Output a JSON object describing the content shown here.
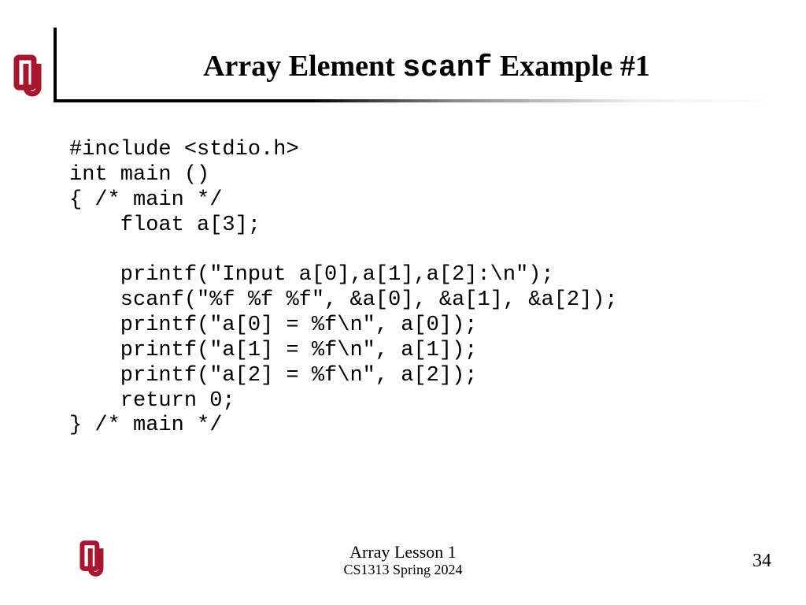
{
  "title": {
    "part1": "Array Element ",
    "mono": "scanf",
    "part2": " Example #1"
  },
  "code_lines": [
    "#include <stdio.h>",
    "int main ()",
    "{ /* main */",
    "    float a[3];",
    "",
    "    printf(\"Input a[0],a[1],a[2]:\\n\");",
    "    scanf(\"%f %f %f\", &a[0], &a[1], &a[2]);",
    "    printf(\"a[0] = %f\\n\", a[0]);",
    "    printf(\"a[1] = %f\\n\", a[1]);",
    "    printf(\"a[2] = %f\\n\", a[2]);",
    "    return 0;",
    "} /* main */"
  ],
  "footer": {
    "title": "Array Lesson 1",
    "sub": "CS1313 Spring 2024",
    "page": "34"
  },
  "logo_color": "#a8152f"
}
